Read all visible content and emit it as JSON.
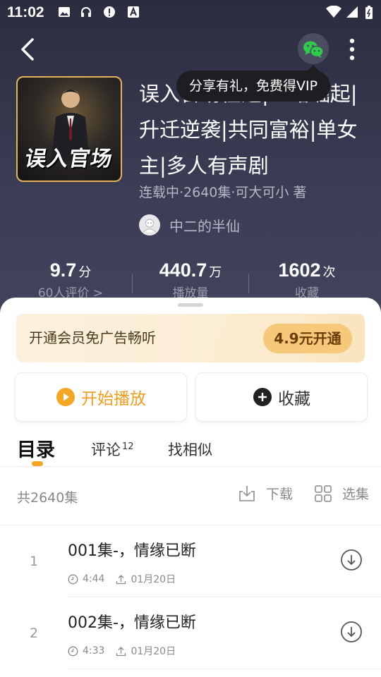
{
  "status_bar": {
    "time": "11:02"
  },
  "tooltip": "分享有礼，免费得VIP",
  "book": {
    "cover_text": "误入官场",
    "title": "误入官场仕途|一路崛起|升迁逆袭|共同富裕|单女主|多人有声剧",
    "meta": "连载中·2640集·可大可小 著",
    "narrator": "中二的半仙"
  },
  "stats": [
    {
      "num": "9.7",
      "unit": "分",
      "label": "60人评价 >"
    },
    {
      "num": "440.7",
      "unit": "万",
      "label": "播放量"
    },
    {
      "num": "1602",
      "unit": "次",
      "label": "收藏"
    }
  ],
  "vip": {
    "text": "开通会员免广告畅听",
    "button": "4.9元开通"
  },
  "actions": {
    "play": "开始播放",
    "favorite": "收藏"
  },
  "tabs": [
    {
      "label": "目录",
      "badge": ""
    },
    {
      "label": "评论",
      "badge": "12"
    },
    {
      "label": "找相似",
      "badge": ""
    }
  ],
  "toolbar": {
    "count": "共2640集",
    "download": "下载",
    "select": "选集"
  },
  "episodes": [
    {
      "index": "1",
      "title": "001集-，情缘已断",
      "duration": "4:44",
      "date": "01月20日"
    },
    {
      "index": "2",
      "title": "002集-，情缘已断",
      "duration": "4:33",
      "date": "01月20日"
    }
  ],
  "colors": {
    "accent": "#f5a623",
    "hero_bg": "#2b2c3f",
    "vip_button": "#f6c87a"
  }
}
